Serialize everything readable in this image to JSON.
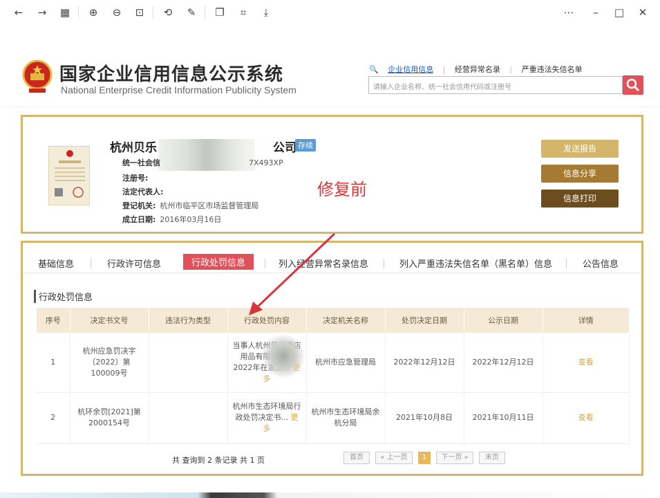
{
  "header": {
    "title_cn": "国家企业信用信息公示系统",
    "title_en": "National Enterprise Credit Information Publicity System",
    "search_tabs": [
      "企业信用信息",
      "经营异常名录",
      "严重违法失信名单"
    ],
    "search_placeholder": "请输入企业名称、统一社会信用代码或注册号"
  },
  "company": {
    "name_start": "杭州贝乐",
    "name_end": "公司",
    "status": "存续",
    "fields": [
      {
        "label": "统一社会信",
        "value": "7X493XP"
      },
      {
        "label": "注册号:",
        "value": ""
      },
      {
        "label": "法定代表人:",
        "value": ""
      },
      {
        "label": "登记机关:",
        "value": "杭州市临平区市场监督管理局"
      },
      {
        "label": "成立日期:",
        "value": "2016年03月16日"
      }
    ],
    "buttons": {
      "send": "发送报告",
      "share": "信息分享",
      "print": "信息打印"
    }
  },
  "annotation": "修复前",
  "tabs": [
    "基础信息",
    "行政许可信息",
    "行政处罚信息",
    "列入经营异常名录信息",
    "列入严重违法失信名单（黑名单）信息",
    "公告信息"
  ],
  "section_title": "行政处罚信息",
  "table": {
    "headers": [
      "序号",
      "决定书文号",
      "违法行为类型",
      "行政处罚内容",
      "决定机关名称",
      "处罚决定日期",
      "公示日期",
      "详情"
    ],
    "rows": [
      {
        "no": "1",
        "doc": "杭州应急罚决字〔2022〕第100009号",
        "type": "",
        "content": "当事人杭州贝乐酒店用品有限公司于2022年在浙江...",
        "more": "更多",
        "org": "杭州市应急管理局",
        "decision_date": "2022年12月12日",
        "publish_date": "2022年12月12日",
        "detail": "查看"
      },
      {
        "no": "2",
        "doc": "杭环余罚[2021]第2000154号",
        "type": "",
        "content": "杭州市生态环境局行政处罚决定书...",
        "more": "更多",
        "org": "杭州市生态环境局余杭分局",
        "decision_date": "2021年10月8日",
        "publish_date": "2021年10月11日",
        "detail": "查看"
      }
    ]
  },
  "pager": {
    "total": "共 查询到 2 条记录 共 1 页",
    "first": "首页",
    "prev": "« 上一页",
    "current": "1",
    "next": "下一页 »",
    "last": "末页"
  }
}
